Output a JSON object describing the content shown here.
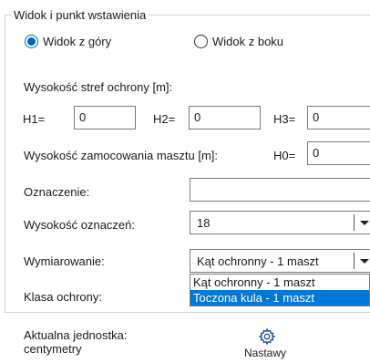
{
  "group": {
    "title": "Widok i punkt wstawienia"
  },
  "view": {
    "top_label": "Widok z góry",
    "side_label": "Widok z boku",
    "selected": "top"
  },
  "zones": {
    "label": "Wysokość stref ochrony [m]:",
    "h1_label": "H1=",
    "h1_value": "0",
    "h2_label": "H2=",
    "h2_value": "0",
    "h3_label": "H3=",
    "h3_value": "0"
  },
  "mast": {
    "label": "Wysokość zamocowania masztu [m]:",
    "h0_label": "H0=",
    "h0_value": "0"
  },
  "designation": {
    "label": "Oznaczenie:",
    "value": ""
  },
  "designation_height": {
    "label": "Wysokość oznaczeń:",
    "value": "18"
  },
  "dimensioning": {
    "label": "Wymiarowanie:",
    "value": "Kąt ochronny - 1 maszt",
    "options": [
      "Kąt ochronny - 1 maszt",
      "Toczona kula - 1 maszt"
    ],
    "highlighted_index": 1
  },
  "protection_class": {
    "label": "Klasa ochrony:"
  },
  "footer": {
    "unit_label": "Aktualna jednostka:",
    "unit_value": "centymetry",
    "settings_label": "Nastawy",
    "settings_icon": "gear-icon"
  },
  "colors": {
    "accent": "#0067c0",
    "highlight": "#0078d7"
  }
}
